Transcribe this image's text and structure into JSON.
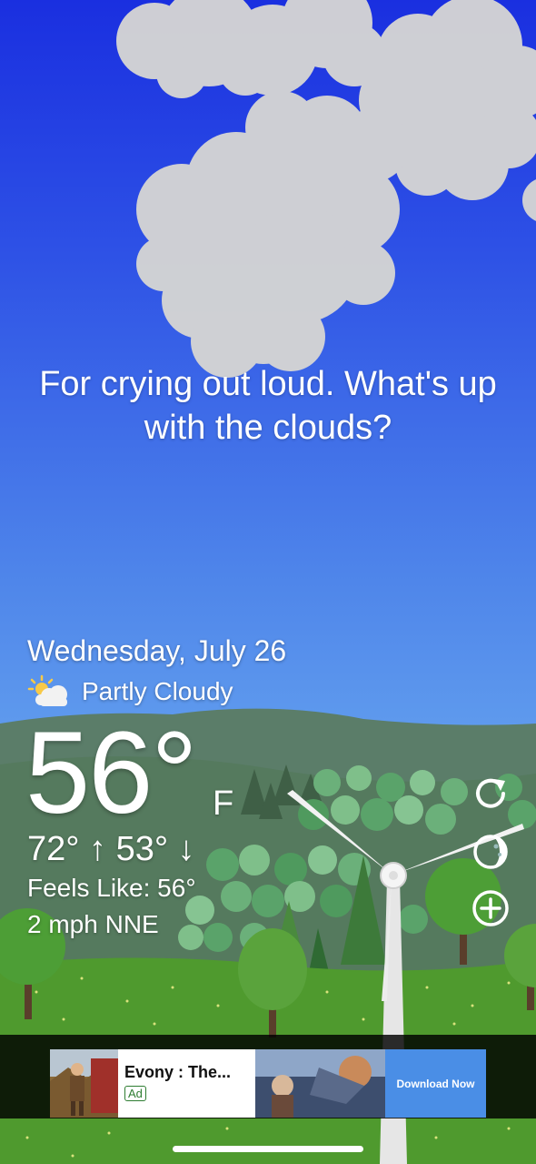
{
  "message": "For crying out loud. What's up with the clouds?",
  "weather": {
    "date": "Wednesday, July 26",
    "condition": "Partly Cloudy",
    "condition_icon": "partly-cloudy-icon",
    "temperature": "56°",
    "unit": "F",
    "hi_lo": "72° ↑  53° ↓",
    "feels_like": "Feels Like: 56°",
    "wind": "2 mph NNE"
  },
  "controls": {
    "refresh_icon": "refresh-icon",
    "moon_icon": "moon-phase-icon",
    "add_icon": "add-circle-icon"
  },
  "ad": {
    "title": "Evony : The...",
    "badge": "Ad",
    "cta": "Download Now"
  },
  "colors": {
    "sky_top": "#1a2fe0",
    "sky_bottom": "#7db9f3",
    "hills": "#5a7c68",
    "grass": "#4f9a2e",
    "ad_cta": "#4a8ee6"
  }
}
